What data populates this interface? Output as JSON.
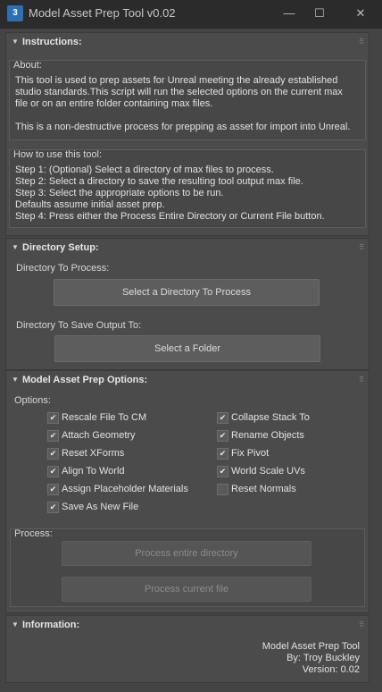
{
  "window": {
    "title": "Model Asset Prep Tool v0.02",
    "app_icon": "3",
    "minimize": "—",
    "maximize": "☐",
    "close": "✕"
  },
  "instructions": {
    "title": "Instructions:",
    "about_label": "About:",
    "about_text": "This tool is used to prep assets for Unreal meeting the already established\nstudio standards.This script will run the selected options on the current max\nfile or on an entire folder containing max files.\n\nThis is a non-destructive process for prepping as asset for import into Unreal.",
    "howto_label": "How to use this tool:",
    "howto_text": "Step 1: (Optional) Select a directory of max files to process.\nStep 2: Select a directory to save the resulting tool output max file.\nStep 3: Select the appropriate options to be run.\nDefaults assume initial asset prep.\nStep 4: Press either the Process Entire Directory or Current File button."
  },
  "directory": {
    "title": "Directory Setup:",
    "process_label": "Directory To Process:",
    "process_button": "Select a Directory To Process",
    "output_label": "Directory To Save Output To:",
    "output_button": "Select a Folder"
  },
  "options": {
    "title": "Model Asset Prep Options:",
    "group_label": "Options:",
    "left": [
      {
        "label": "Rescale File To CM",
        "checked": true
      },
      {
        "label": "Attach Geometry",
        "checked": true
      },
      {
        "label": "Reset XForms",
        "checked": true
      },
      {
        "label": "Align To World",
        "checked": true
      },
      {
        "label": "Assign Placeholder Materials",
        "checked": true
      },
      {
        "label": "Save As New File",
        "checked": true
      }
    ],
    "right": [
      {
        "label": "Collapse Stack To",
        "checked": true
      },
      {
        "label": "Rename Objects",
        "checked": true
      },
      {
        "label": "Fix Pivot",
        "checked": true
      },
      {
        "label": "World Scale UVs",
        "checked": true
      },
      {
        "label": "Reset Normals",
        "checked": false
      }
    ],
    "process_label": "Process:",
    "process_dir_button": "Process entire directory",
    "process_file_button": "Process current file"
  },
  "information": {
    "title": "Information:",
    "line1": "Model Asset Prep Tool",
    "line2": "By: Troy Buckley",
    "line3": "Version: 0.02"
  },
  "icons": {
    "collapse": "▼",
    "grip": "⠿",
    "check": "✔"
  }
}
